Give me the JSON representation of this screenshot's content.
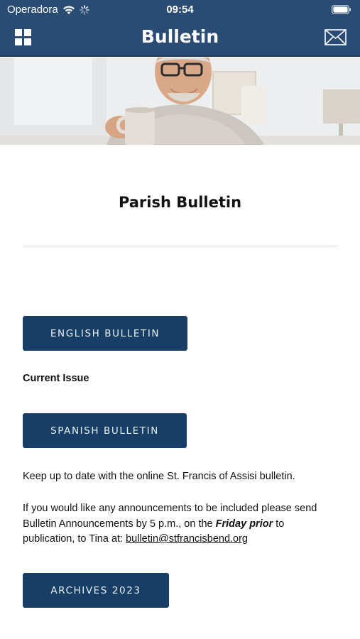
{
  "status_bar": {
    "carrier": "Operadora",
    "time": "09:54"
  },
  "nav": {
    "title": "Bulletin",
    "menu_icon": "grid-icon",
    "mail_icon": "mail-icon"
  },
  "page": {
    "title": "Parish Bulletin"
  },
  "buttons": {
    "english": "ENGLISH BULLETIN",
    "spanish": "SPANISH BULLETIN",
    "archives": "ARCHIVES 2023"
  },
  "current_issue": "Current Issue",
  "intro": "Keep up to date with the online St. Francis of Assisi bulletin.",
  "announcement": {
    "before": "If you would like any announcements to be included please send Bulletin Announcements by 5 p.m., on the ",
    "emphasis": "Friday prior",
    "after": " to publication, to Tina at:  ",
    "email": "bulletin@stfrancisbend.org"
  },
  "colors": {
    "header": "#2a4c74",
    "button": "#163e66"
  }
}
